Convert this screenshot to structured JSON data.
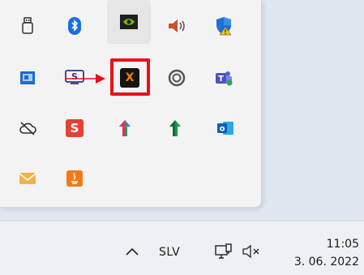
{
  "tray": {
    "icons": [
      {
        "name": "usb-drive-icon"
      },
      {
        "name": "bluetooth-icon"
      },
      {
        "name": "nvidia-icon"
      },
      {
        "name": "speaker-icon"
      },
      {
        "name": "windows-security-icon"
      },
      {
        "name": "remote-desktop-icon"
      },
      {
        "name": "s-shield-icon"
      },
      {
        "name": "xampp-icon",
        "label": "X"
      },
      {
        "name": "steelseries-icon"
      },
      {
        "name": "teams-icon"
      },
      {
        "name": "cloud-off-icon"
      },
      {
        "name": "s-app-icon",
        "label": "S"
      },
      {
        "name": "colorful-arrow-icon"
      },
      {
        "name": "green-arrow-icon"
      },
      {
        "name": "outlook-icon",
        "label": "o"
      },
      {
        "name": "mail-icon"
      },
      {
        "name": "java-icon"
      }
    ],
    "highlight_color": "#e8101a"
  },
  "taskbar": {
    "language": "SLV",
    "time": "11:05",
    "date": "3. 06. 2022"
  }
}
